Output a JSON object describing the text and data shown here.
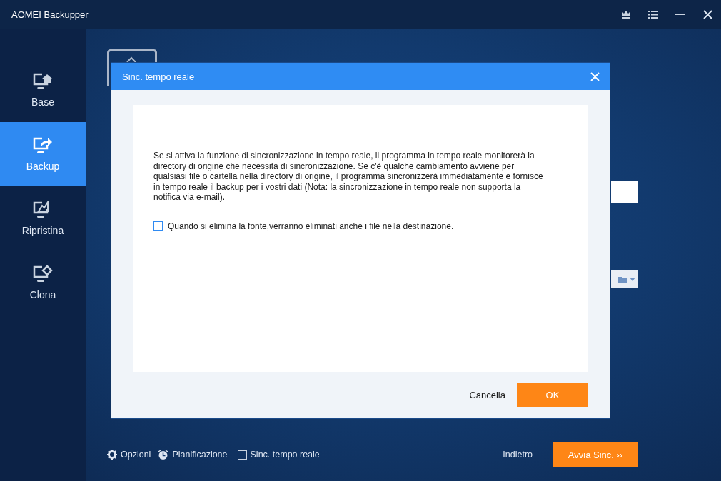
{
  "window": {
    "title": "AOMEI Backupper"
  },
  "sidebar": {
    "items": [
      {
        "label": "Base",
        "selected": false
      },
      {
        "label": "Backup",
        "selected": true
      },
      {
        "label": "Ripristina",
        "selected": false
      },
      {
        "label": "Clona",
        "selected": false
      }
    ]
  },
  "dialog": {
    "title": "Sinc. tempo reale",
    "description": "Se si attiva la funzione di sincronizzazione in tempo reale, il programma in tempo reale monitorerà la directory di origine che necessita di sincronizzazione. Se c'è qualche cambiamento avviene per qualsiasi file o cartella nella directory di origine, il programma sincronizzerà immediatamente e fornisce in tempo reale il backup per i vostri dati (Nota: la sincronizzazione in tempo reale non supporta la notifica via e-mail).",
    "option": {
      "label": "Quando si elimina la fonte,verranno eliminati anche i file nella destinazione.",
      "checked": false
    },
    "cancel": "Cancella",
    "ok": "OK"
  },
  "footer": {
    "options": "Opzioni",
    "schedule": "Pianificazione",
    "realtime": {
      "label": "Sinc. tempo reale",
      "checked": false
    },
    "back": "Indietro",
    "start": "Avvia Sinc. ››"
  }
}
